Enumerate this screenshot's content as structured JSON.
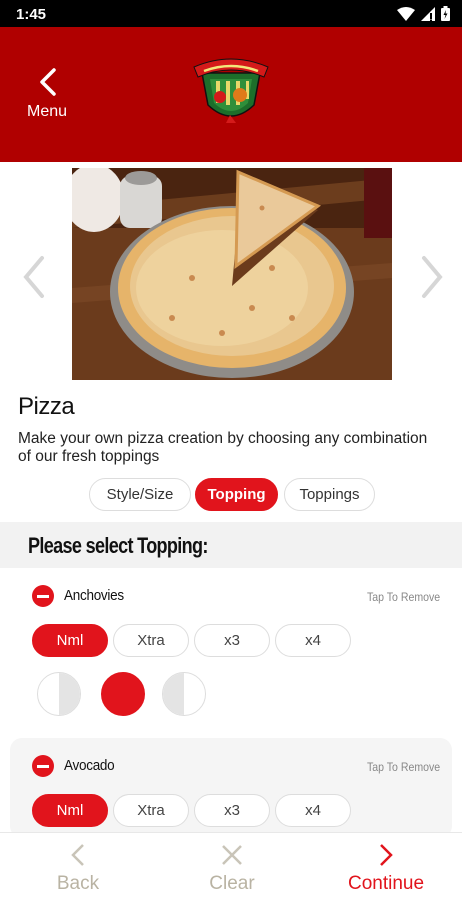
{
  "status_bar": {
    "time": "1:45",
    "icons": [
      "wifi-icon",
      "signal-icon",
      "battery-icon"
    ]
  },
  "header": {
    "back_label": "Menu",
    "logo": "Giovanni's"
  },
  "product": {
    "title": "Pizza",
    "description": "Make your own pizza creation by choosing any combination of our fresh toppings"
  },
  "tabs": [
    {
      "label": "Style/Size",
      "active": false
    },
    {
      "label": "Topping",
      "active": true
    },
    {
      "label": "Toppings",
      "active": false
    }
  ],
  "section": {
    "heading": "Please select Topping:"
  },
  "toppings": [
    {
      "name": "Anchovies",
      "action": "Tap To Remove",
      "amounts": [
        "Nml",
        "Xtra",
        "x3",
        "x4"
      ],
      "selected_amount": "Nml",
      "portions": [
        "left-half",
        "whole",
        "right-half"
      ],
      "selected_portion": "whole"
    },
    {
      "name": "Avocado",
      "action": "Tap To Remove",
      "amounts": [
        "Nml",
        "Xtra",
        "x3",
        "x4"
      ],
      "selected_amount": "Nml"
    }
  ],
  "bottom_bar": {
    "back_label": "Back",
    "clear_label": "Clear",
    "continue_label": "Continue"
  },
  "colors": {
    "header": "#b00000",
    "accent": "#e1141c",
    "disabled": "#b9b3a3"
  }
}
